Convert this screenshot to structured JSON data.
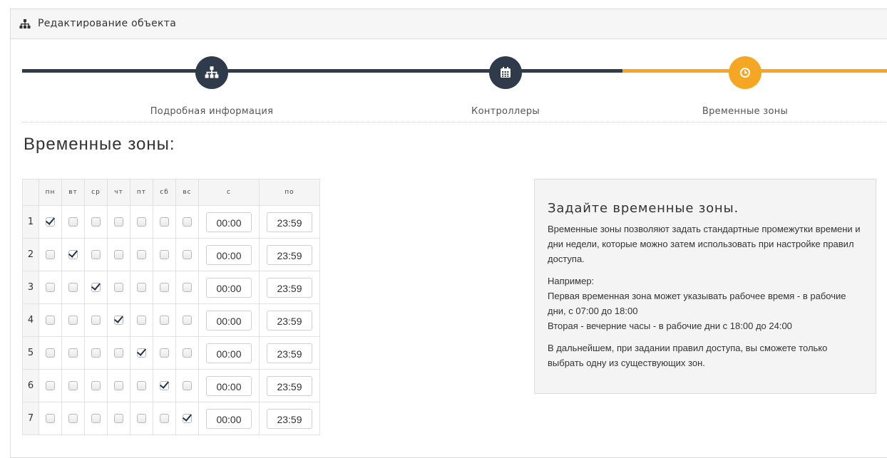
{
  "header": {
    "title": "Редактирование объекта",
    "icon": "sitemap-icon"
  },
  "wizard": {
    "steps": [
      {
        "label": "Подробная информация",
        "icon": "sitemap-icon",
        "state": "done"
      },
      {
        "label": "Контроллеры",
        "icon": "calendar-icon",
        "state": "done"
      },
      {
        "label": "Временные зоны",
        "icon": "clock-icon",
        "state": "active"
      }
    ],
    "colors": {
      "done": "#2f3a4a",
      "active": "#f5a623"
    }
  },
  "section": {
    "title": "Временные зоны:"
  },
  "table": {
    "headers": [
      "пн",
      "вт",
      "ср",
      "чт",
      "пт",
      "сб",
      "вс",
      "с",
      "по"
    ],
    "rows": [
      {
        "num": "1",
        "days": [
          true,
          false,
          false,
          false,
          false,
          false,
          false
        ],
        "from": "00:00",
        "to": "23:59"
      },
      {
        "num": "2",
        "days": [
          false,
          true,
          false,
          false,
          false,
          false,
          false
        ],
        "from": "00:00",
        "to": "23:59"
      },
      {
        "num": "3",
        "days": [
          false,
          false,
          true,
          false,
          false,
          false,
          false
        ],
        "from": "00:00",
        "to": "23:59"
      },
      {
        "num": "4",
        "days": [
          false,
          false,
          false,
          true,
          false,
          false,
          false
        ],
        "from": "00:00",
        "to": "23:59"
      },
      {
        "num": "5",
        "days": [
          false,
          false,
          false,
          false,
          true,
          false,
          false
        ],
        "from": "00:00",
        "to": "23:59"
      },
      {
        "num": "6",
        "days": [
          false,
          false,
          false,
          false,
          false,
          true,
          false
        ],
        "from": "00:00",
        "to": "23:59"
      },
      {
        "num": "7",
        "days": [
          false,
          false,
          false,
          false,
          false,
          false,
          true
        ],
        "from": "00:00",
        "to": "23:59"
      }
    ]
  },
  "info": {
    "title": "Задайте временные зоны.",
    "p1": "Временные зоны позволяют задать стандартные промежутки времени и дни недели, которые можно затем использовать при настройке правил доступа.",
    "p2_line1": "Например:",
    "p2_line2": "Первая временная зона может указывать рабочее время - в рабочие дни, с 07:00 до 18:00",
    "p2_line3": "Вторая - вечерние часы - в рабочие дни с 18:00 до 24:00",
    "p3": "В дальнейшем, при задании правил доступа, вы сможете только выбрать одну из существующих зон."
  }
}
